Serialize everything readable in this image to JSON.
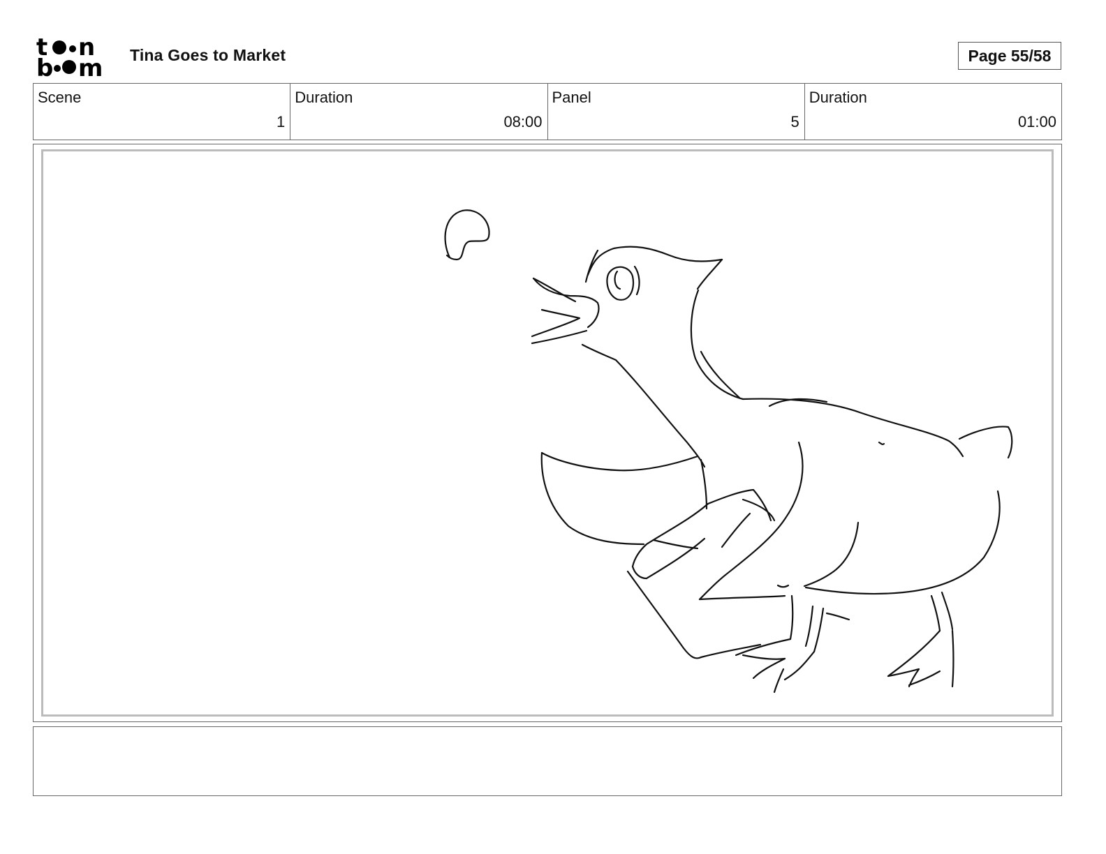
{
  "header": {
    "logo_text": "toonboom",
    "project_title": "Tina Goes to Market",
    "page_label": "Page 55/58"
  },
  "info": [
    {
      "label": "Scene",
      "value": "1"
    },
    {
      "label": "Duration",
      "value": "08:00"
    },
    {
      "label": "Panel",
      "value": "5"
    },
    {
      "label": "Duration",
      "value": "01:00"
    }
  ],
  "panel": {
    "drawing": "duck-sketch"
  },
  "notes": {
    "text": ""
  }
}
